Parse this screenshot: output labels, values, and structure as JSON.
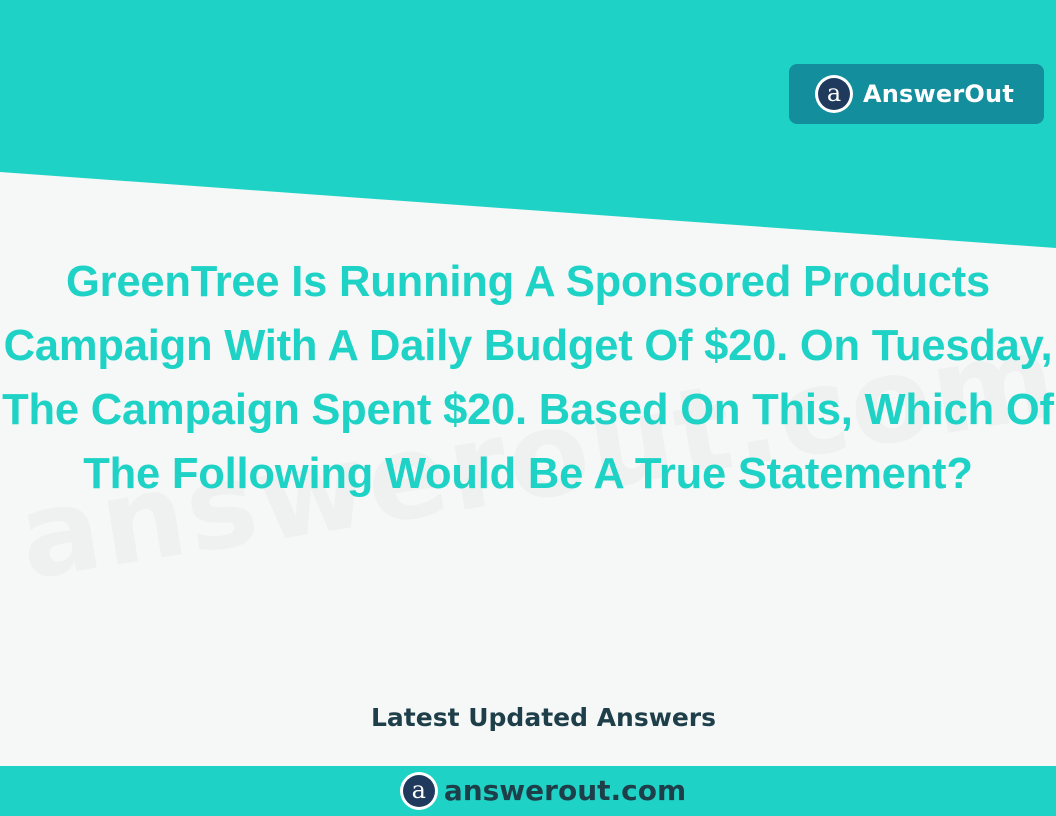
{
  "header": {
    "brand_name": "AnswerOut",
    "logo_glyph": "a",
    "logo_icon": "answerout-logo-icon"
  },
  "question": {
    "text": "GreenTree Is Running A Sponsored Products Campaign With A Daily Budget Of $20. On Tuesday, The Campaign Spent $20. Based On This, Which Of The Following Would Be A True Statement?"
  },
  "tagline": {
    "text": "Latest Updated Answers"
  },
  "footer": {
    "site_url": "answerout.com",
    "logo_glyph": "a",
    "logo_icon": "answerout-logo-icon"
  },
  "watermark": {
    "text": "answerout.com"
  },
  "colors": {
    "teal": "#1ed3c6",
    "badge_bg": "#138e9c",
    "dark_text": "#1e3f4a",
    "logo_bg": "#1f3a5c",
    "background": "#f6f7f7"
  }
}
